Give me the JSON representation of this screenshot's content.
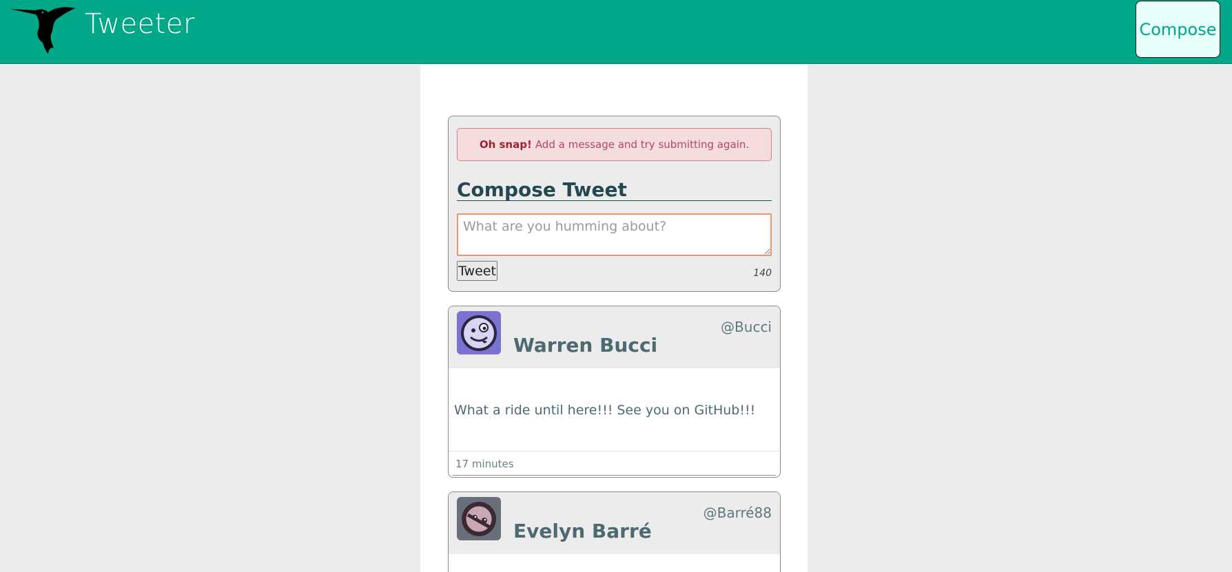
{
  "nav": {
    "brand": "Tweeter",
    "compose_label": "Compose",
    "logo_icon": "hummingbird-icon"
  },
  "compose": {
    "alert_strong": "Oh snap!",
    "alert_text": "Add a message and try submitting again.",
    "title": "Compose Tweet",
    "placeholder": "What are you humming about?",
    "tweet_label": "Tweet",
    "counter": "140"
  },
  "tweets": [
    {
      "name": "Warren Bucci",
      "handle": "@Bucci",
      "body": "What a ride until here!!! See you on GitHub!!!",
      "time": "17 minutes",
      "avatar_icon": "avatar-face-icon"
    },
    {
      "name": "Evelyn Barré",
      "handle": "@Barré88",
      "avatar_icon": "avatar-face-icon"
    }
  ],
  "colors": {
    "nav_bg": "#00a887",
    "alert_bg": "#f5dcdd",
    "heading": "#244751",
    "accent_border": "#e89470"
  }
}
